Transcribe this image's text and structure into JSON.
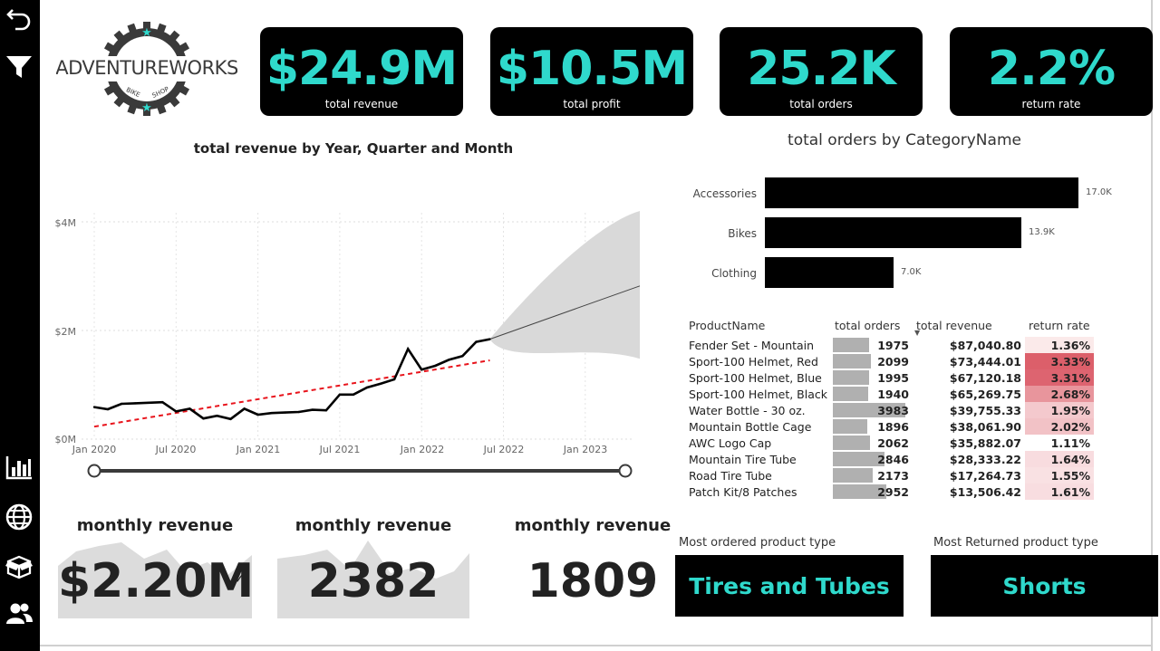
{
  "kpis": [
    {
      "value": "$24.9M",
      "label": "total revenue"
    },
    {
      "value": "$10.5M",
      "label": "total profit"
    },
    {
      "value": "25.2K",
      "label": "total orders"
    },
    {
      "value": "2.2%",
      "label": "return rate"
    }
  ],
  "logo": {
    "text": "ADVENTUREWORKS",
    "bike": "BIKE",
    "shop": "SHOP"
  },
  "revenue_chart": {
    "title": "total revenue by Year, Quarter and Month",
    "y_ticks": [
      "$4M",
      "$2M",
      "$0M"
    ],
    "x_ticks": [
      "Jan 2020",
      "Jul 2020",
      "Jan 2021",
      "Jul 2021",
      "Jan 2022",
      "Jul 2022",
      "Jan 2023"
    ]
  },
  "orders_chart": {
    "title": "total orders by CategoryName",
    "labels": [
      "Accessories",
      "Bikes",
      "Clothing"
    ],
    "value_labels": [
      "17.0K",
      "13.9K",
      "7.0K"
    ]
  },
  "chart_data": [
    {
      "type": "line",
      "title": "total revenue by Year, Quarter and Month",
      "xlabel": "",
      "ylabel": "",
      "ylim": [
        0,
        4500000
      ],
      "x": [
        "2020-01",
        "2020-02",
        "2020-03",
        "2020-04",
        "2020-05",
        "2020-06",
        "2020-07",
        "2020-08",
        "2020-09",
        "2020-10",
        "2020-11",
        "2020-12",
        "2021-01",
        "2021-02",
        "2021-03",
        "2021-04",
        "2021-05",
        "2021-06",
        "2021-07",
        "2021-08",
        "2021-09",
        "2021-10",
        "2021-11",
        "2021-12",
        "2022-01",
        "2022-02",
        "2022-03",
        "2022-04",
        "2022-05",
        "2022-06"
      ],
      "series": [
        {
          "values": [
            590000,
            550000,
            650000,
            660000,
            670000,
            680000,
            510000,
            560000,
            380000,
            430000,
            370000,
            560000,
            450000,
            480000,
            490000,
            500000,
            540000,
            530000,
            820000,
            820000,
            950000,
            1020000,
            1100000,
            1660000,
            1280000,
            1350000,
            1460000,
            1530000,
            1790000,
            1840000
          ]
        }
      ],
      "trend_line": {
        "start": 230000,
        "end": 1450000
      },
      "forecast": {
        "x": [
          "2022-06",
          "2023-05"
        ],
        "values": [
          1840000,
          2820000
        ],
        "upper": [
          1840000,
          4200000
        ],
        "lower": [
          1840000,
          1480000
        ]
      }
    },
    {
      "type": "bar",
      "title": "total orders by CategoryName",
      "categories": [
        "Accessories",
        "Bikes",
        "Clothing"
      ],
      "values": [
        17000,
        13900,
        7000
      ]
    }
  ],
  "product_table": {
    "headers": {
      "name": "ProductName",
      "orders": "total orders",
      "revenue": "total revenue",
      "return_rate": "return rate"
    },
    "max_orders": 3983,
    "rows": [
      {
        "name": "Fender Set - Mountain",
        "orders": "1975",
        "orders_num": 1975,
        "revenue": "$87,040.80",
        "return_rate": "1.36%",
        "rr_color": "#fbeaea"
      },
      {
        "name": "Sport-100 Helmet, Red",
        "orders": "2099",
        "orders_num": 2099,
        "revenue": "$73,444.01",
        "return_rate": "3.33%",
        "rr_color": "#dc5f6a"
      },
      {
        "name": "Sport-100 Helmet, Blue",
        "orders": "1995",
        "orders_num": 1995,
        "revenue": "$67,120.18",
        "return_rate": "3.31%",
        "rr_color": "#dd6470"
      },
      {
        "name": "Sport-100 Helmet, Black",
        "orders": "1940",
        "orders_num": 1940,
        "revenue": "$65,269.75",
        "return_rate": "2.68%",
        "rr_color": "#e8959c"
      },
      {
        "name": "Water Bottle - 30 oz.",
        "orders": "3983",
        "orders_num": 3983,
        "revenue": "$39,755.33",
        "return_rate": "1.95%",
        "rr_color": "#f4c9cd"
      },
      {
        "name": "Mountain Bottle Cage",
        "orders": "1896",
        "orders_num": 1896,
        "revenue": "$38,061.90",
        "return_rate": "2.02%",
        "rr_color": "#f2c2c6"
      },
      {
        "name": "AWC Logo Cap",
        "orders": "2062",
        "orders_num": 2062,
        "revenue": "$35,882.07",
        "return_rate": "1.11%",
        "rr_color": "#ffffff"
      },
      {
        "name": "Mountain Tire Tube",
        "orders": "2846",
        "orders_num": 2846,
        "revenue": "$28,333.22",
        "return_rate": "1.64%",
        "rr_color": "#f8dcdf"
      },
      {
        "name": "Road Tire Tube",
        "orders": "2173",
        "orders_num": 2173,
        "revenue": "$17,264.73",
        "return_rate": "1.55%",
        "rr_color": "#f9e1e3"
      },
      {
        "name": "Patch Kit/8 Patches",
        "orders": "2952",
        "orders_num": 2952,
        "revenue": "$13,506.42",
        "return_rate": "1.61%",
        "rr_color": "#f8dde0"
      }
    ]
  },
  "monthly_cards": [
    {
      "title": "monthly revenue",
      "value": "$2.20M"
    },
    {
      "title": "monthly revenue",
      "value": "2382"
    },
    {
      "title": "monthly revenue",
      "value": "1809"
    }
  ],
  "product_types": {
    "most_ordered_label": "Most ordered product type",
    "most_ordered_value": "Tires and Tubes",
    "most_returned_label": "Most Returned product type",
    "most_returned_value": "Shorts"
  },
  "colors": {
    "accent": "#2fd9cc",
    "card_bg": "#000000",
    "trend": "#e8141c",
    "forecast_band": "#d9d9d9"
  },
  "sidebar_icons": [
    "back-arrow-icon",
    "filter-icon",
    "bar-chart-icon",
    "globe-icon",
    "box-icon",
    "users-icon"
  ]
}
